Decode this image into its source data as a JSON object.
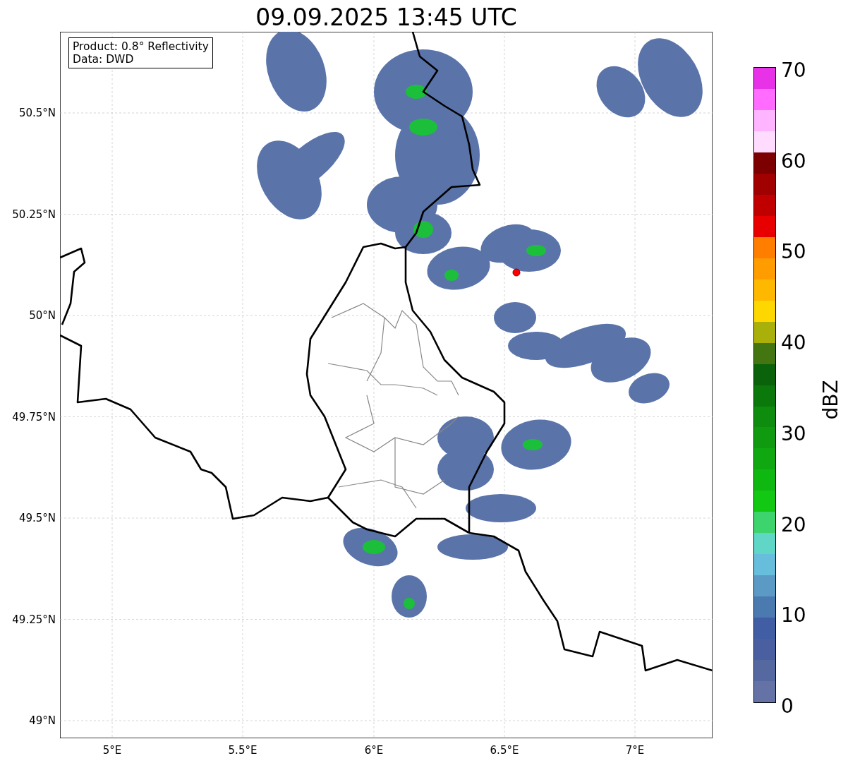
{
  "title": "09.09.2025 13:45 UTC",
  "info_box": [
    "Product: 0.8° Reflectivity",
    "Data: DWD"
  ],
  "y_ticks": [
    "50.5°N",
    "50.25°N",
    "50°N",
    "49.75°N",
    "49.5°N",
    "49.25°N",
    "49°N"
  ],
  "x_ticks": [
    "5°E",
    "5.5°E",
    "6°E",
    "6.5°E",
    "7°E"
  ],
  "colorbar": {
    "label": "dBZ",
    "ticks": [
      "70",
      "60",
      "50",
      "40",
      "30",
      "20",
      "10",
      "0"
    ]
  }
}
